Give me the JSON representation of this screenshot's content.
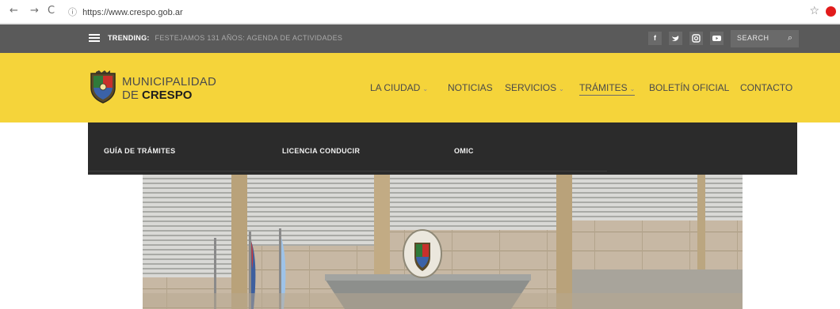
{
  "browser": {
    "back": "←",
    "forward": "→",
    "reload": "C",
    "info": "ⓘ",
    "url": "https://www.crespo.gob.ar",
    "star": "☆",
    "extension_icon": "adblock-icon"
  },
  "topbar": {
    "trending_label": "TRENDING:",
    "trending_text": "FESTEJAMOS 131 AÑOS: AGENDA DE ACTIVIDADES",
    "social": [
      {
        "name": "facebook-icon",
        "glyph": "f"
      },
      {
        "name": "twitter-icon",
        "glyph": "t"
      },
      {
        "name": "instagram-icon",
        "glyph": "◙"
      },
      {
        "name": "youtube-icon",
        "glyph": "▶"
      }
    ],
    "search_label": "SEARCH",
    "search_glyph": "⌕"
  },
  "header": {
    "brand_line1": "MUNICIPALIDAD",
    "brand_line2_prefix": "DE",
    "brand_line2_bold": "CRESPO",
    "menu": [
      {
        "label": "LA CIUDAD",
        "has_caret": true
      },
      {
        "label": "NOTICIAS",
        "has_caret": false
      },
      {
        "label": "SERVICIOS",
        "has_caret": true
      },
      {
        "label": "TRÁMITES",
        "has_caret": true,
        "active": true
      },
      {
        "label": "BOLETÍN OFICIAL",
        "has_caret": false
      },
      {
        "label": "CONTACTO",
        "has_caret": false
      }
    ],
    "caret_glyph": "⌄"
  },
  "dropdown": {
    "items": [
      "GUÍA DE TRÁMITES",
      "LICENCIA CONDUCIR",
      "OMIC"
    ]
  },
  "colors": {
    "topbar": "#5a5a5a",
    "header": "#f5d43a",
    "dropdown": "#2b2b2b",
    "accent_red": "#e21b1b"
  }
}
